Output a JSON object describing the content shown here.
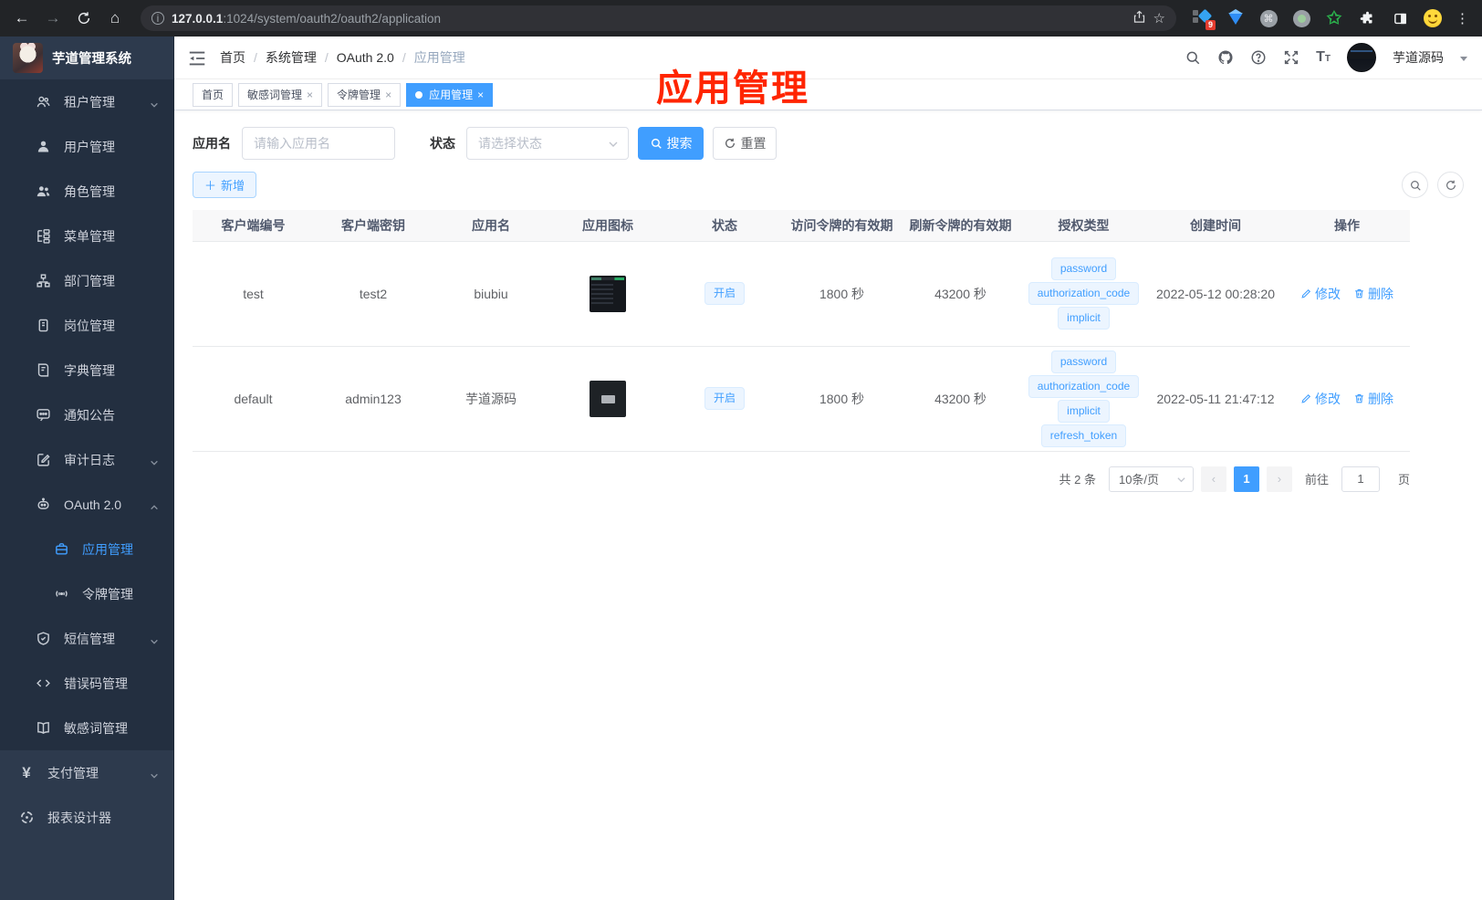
{
  "browser": {
    "url_host": "127.0.0.1",
    "url_path": ":1024/system/oauth2/oauth2/application",
    "extension_badge": "9"
  },
  "sidebar": {
    "logo_title": "芋道管理系统",
    "menu": [
      {
        "label": "租户管理"
      },
      {
        "label": "用户管理"
      },
      {
        "label": "角色管理"
      },
      {
        "label": "菜单管理"
      },
      {
        "label": "部门管理"
      },
      {
        "label": "岗位管理"
      },
      {
        "label": "字典管理"
      },
      {
        "label": "通知公告"
      },
      {
        "label": "审计日志"
      },
      {
        "label": "OAuth 2.0"
      },
      {
        "label": "应用管理"
      },
      {
        "label": "令牌管理"
      },
      {
        "label": "短信管理"
      },
      {
        "label": "错误码管理"
      },
      {
        "label": "敏感词管理"
      },
      {
        "label": "支付管理"
      },
      {
        "label": "报表设计器"
      }
    ]
  },
  "header": {
    "breadcrumb": [
      "首页",
      "系统管理",
      "OAuth 2.0",
      "应用管理"
    ],
    "username": "芋道源码"
  },
  "tabs": [
    {
      "label": "首页"
    },
    {
      "label": "敏感词管理"
    },
    {
      "label": "令牌管理"
    },
    {
      "label": "应用管理"
    }
  ],
  "annotation": "应用管理",
  "filters": {
    "app_name_label": "应用名",
    "app_name_placeholder": "请输入应用名",
    "status_label": "状态",
    "status_placeholder": "请选择状态",
    "search_label": "搜索",
    "reset_label": "重置",
    "add_label": "新增"
  },
  "table": {
    "columns": [
      "客户端编号",
      "客户端密钥",
      "应用名",
      "应用图标",
      "状态",
      "访问令牌的有效期",
      "刷新令牌的有效期",
      "授权类型",
      "创建时间",
      "操作"
    ],
    "rows": [
      {
        "client_id": "test",
        "secret": "test2",
        "name": "biubiu",
        "status": "开启",
        "access_ttl": "1800 秒",
        "refresh_ttl": "43200 秒",
        "grants": [
          "password",
          "authorization_code",
          "implicit"
        ],
        "created": "2022-05-12 00:28:20"
      },
      {
        "client_id": "default",
        "secret": "admin123",
        "name": "芋道源码",
        "status": "开启",
        "access_ttl": "1800 秒",
        "refresh_ttl": "43200 秒",
        "grants": [
          "password",
          "authorization_code",
          "implicit",
          "refresh_token"
        ],
        "created": "2022-05-11 21:47:12"
      }
    ],
    "edit_label": "修改",
    "delete_label": "删除"
  },
  "pagination": {
    "total": "共 2 条",
    "page_size": "10条/页",
    "current_page": "1",
    "goto_label": "前往",
    "goto_value": "1",
    "page_label": "页"
  },
  "colors": {
    "accent": "#409eff",
    "annotation_red": "#ff2500",
    "sidebar_bg": "#2d3a4d",
    "submenu_bg": "#232f40",
    "tag_bg": "#ecf5ff",
    "tag_border": "#d9ecff"
  },
  "icons": {
    "nav": [
      "search-icon",
      "github-icon",
      "help-icon",
      "fullscreen-icon",
      "font-size-icon"
    ],
    "ops": [
      "edit-pencil-icon",
      "delete-trash-icon"
    ]
  }
}
